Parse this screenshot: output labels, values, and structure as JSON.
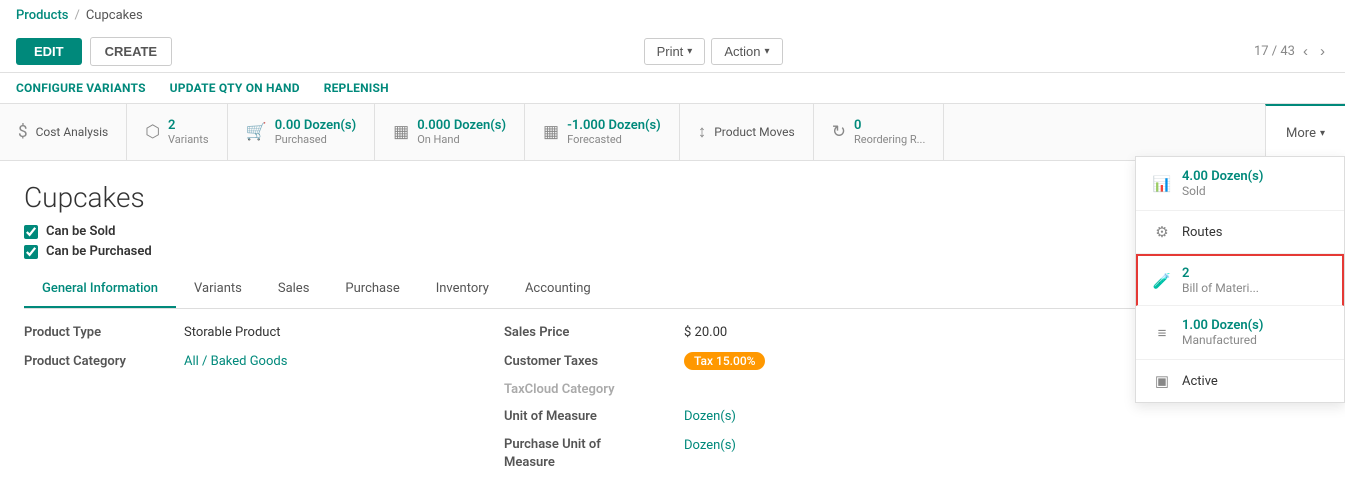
{
  "breadcrumb": {
    "parent_label": "Products",
    "separator": "/",
    "current_label": "Cupcakes"
  },
  "header": {
    "edit_label": "EDIT",
    "create_label": "CREATE",
    "print_label": "Print",
    "action_label": "Action",
    "pagination": "17 / 43"
  },
  "action_bar": {
    "configure_variants": "CONFIGURE VARIANTS",
    "update_qty": "UPDATE QTY ON HAND",
    "replenish": "REPLENISH"
  },
  "stats": [
    {
      "id": "cost-analysis",
      "icon": "$",
      "value": "",
      "label": "Cost Analysis"
    },
    {
      "id": "variants",
      "icon": "⬡",
      "value": "2",
      "label": "Variants"
    },
    {
      "id": "purchased",
      "icon": "🛒",
      "value": "0.00 Dozen(s)",
      "label": "Purchased"
    },
    {
      "id": "on-hand",
      "icon": "▦",
      "value": "0.000 Dozen(s)",
      "label": "On Hand"
    },
    {
      "id": "forecasted",
      "icon": "▦",
      "value": "-1.000 Dozen(s)",
      "label": "Forecasted"
    },
    {
      "id": "product-moves",
      "icon": "↕",
      "value": "",
      "label": "Product Moves"
    },
    {
      "id": "reordering",
      "icon": "↻",
      "value": "0",
      "label": "Reordering R..."
    }
  ],
  "more_label": "More",
  "dropdown_items": [
    {
      "id": "sold",
      "icon": "📊",
      "value": "4.00 Dozen(s)",
      "label": "Sold",
      "highlighted": false
    },
    {
      "id": "routes",
      "icon": "⚙",
      "value": "",
      "label": "Routes",
      "highlighted": false
    },
    {
      "id": "bom",
      "icon": "🧪",
      "value": "2",
      "label": "Bill of Materi...",
      "highlighted": true
    },
    {
      "id": "manufactured",
      "icon": "≡",
      "value": "1.00 Dozen(s)",
      "label": "Manufactured",
      "highlighted": false
    },
    {
      "id": "active",
      "icon": "▣",
      "value": "",
      "label": "Active",
      "highlighted": false
    }
  ],
  "product": {
    "name": "Cupcakes",
    "can_be_sold": "Can be Sold",
    "can_be_purchased": "Can be Purchased"
  },
  "tabs": [
    {
      "id": "general",
      "label": "General Information",
      "active": true
    },
    {
      "id": "variants",
      "label": "Variants",
      "active": false
    },
    {
      "id": "sales",
      "label": "Sales",
      "active": false
    },
    {
      "id": "purchase",
      "label": "Purchase",
      "active": false
    },
    {
      "id": "inventory",
      "label": "Inventory",
      "active": false
    },
    {
      "id": "accounting",
      "label": "Accounting",
      "active": false
    }
  ],
  "fields_left": [
    {
      "label": "Product Type",
      "value": "Storable Product",
      "link": false
    },
    {
      "label": "Product Category",
      "value": "All / Baked Goods",
      "link": true
    }
  ],
  "fields_right": [
    {
      "label": "Sales Price",
      "value": "$ 20.00",
      "link": false
    },
    {
      "label": "Customer Taxes",
      "value": "Tax 15.00%",
      "badge": true
    },
    {
      "label": "TaxCloud Category",
      "value": "",
      "muted": true
    },
    {
      "label": "Unit of Measure",
      "value": "Dozen(s)",
      "link": true
    },
    {
      "label": "Purchase Unit of\nMeasure",
      "value": "Dozen(s)",
      "link": true
    }
  ]
}
